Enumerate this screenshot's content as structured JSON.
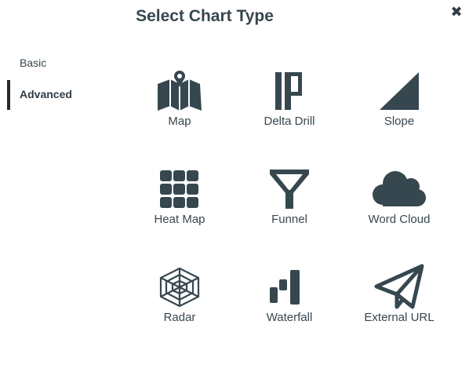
{
  "dialog": {
    "title": "Select Chart Type",
    "close_icon": "close-icon"
  },
  "sidebar": {
    "items": [
      {
        "label": "Basic",
        "active": false
      },
      {
        "label": "Advanced",
        "active": true
      }
    ]
  },
  "chart_types": [
    {
      "label": "Map",
      "icon": "map-icon"
    },
    {
      "label": "Delta Drill",
      "icon": "delta-drill-icon"
    },
    {
      "label": "Slope",
      "icon": "slope-icon"
    },
    {
      "label": "Heat Map",
      "icon": "heat-map-icon"
    },
    {
      "label": "Funnel",
      "icon": "funnel-icon"
    },
    {
      "label": "Word Cloud",
      "icon": "word-cloud-icon"
    },
    {
      "label": "Radar",
      "icon": "radar-icon"
    },
    {
      "label": "Waterfall",
      "icon": "waterfall-icon"
    },
    {
      "label": "External URL",
      "icon": "external-url-icon"
    }
  ],
  "colors": {
    "icon": "#37474f",
    "text": "#37474f",
    "active_indicator": "#1f2a33",
    "background": "#ffffff"
  }
}
